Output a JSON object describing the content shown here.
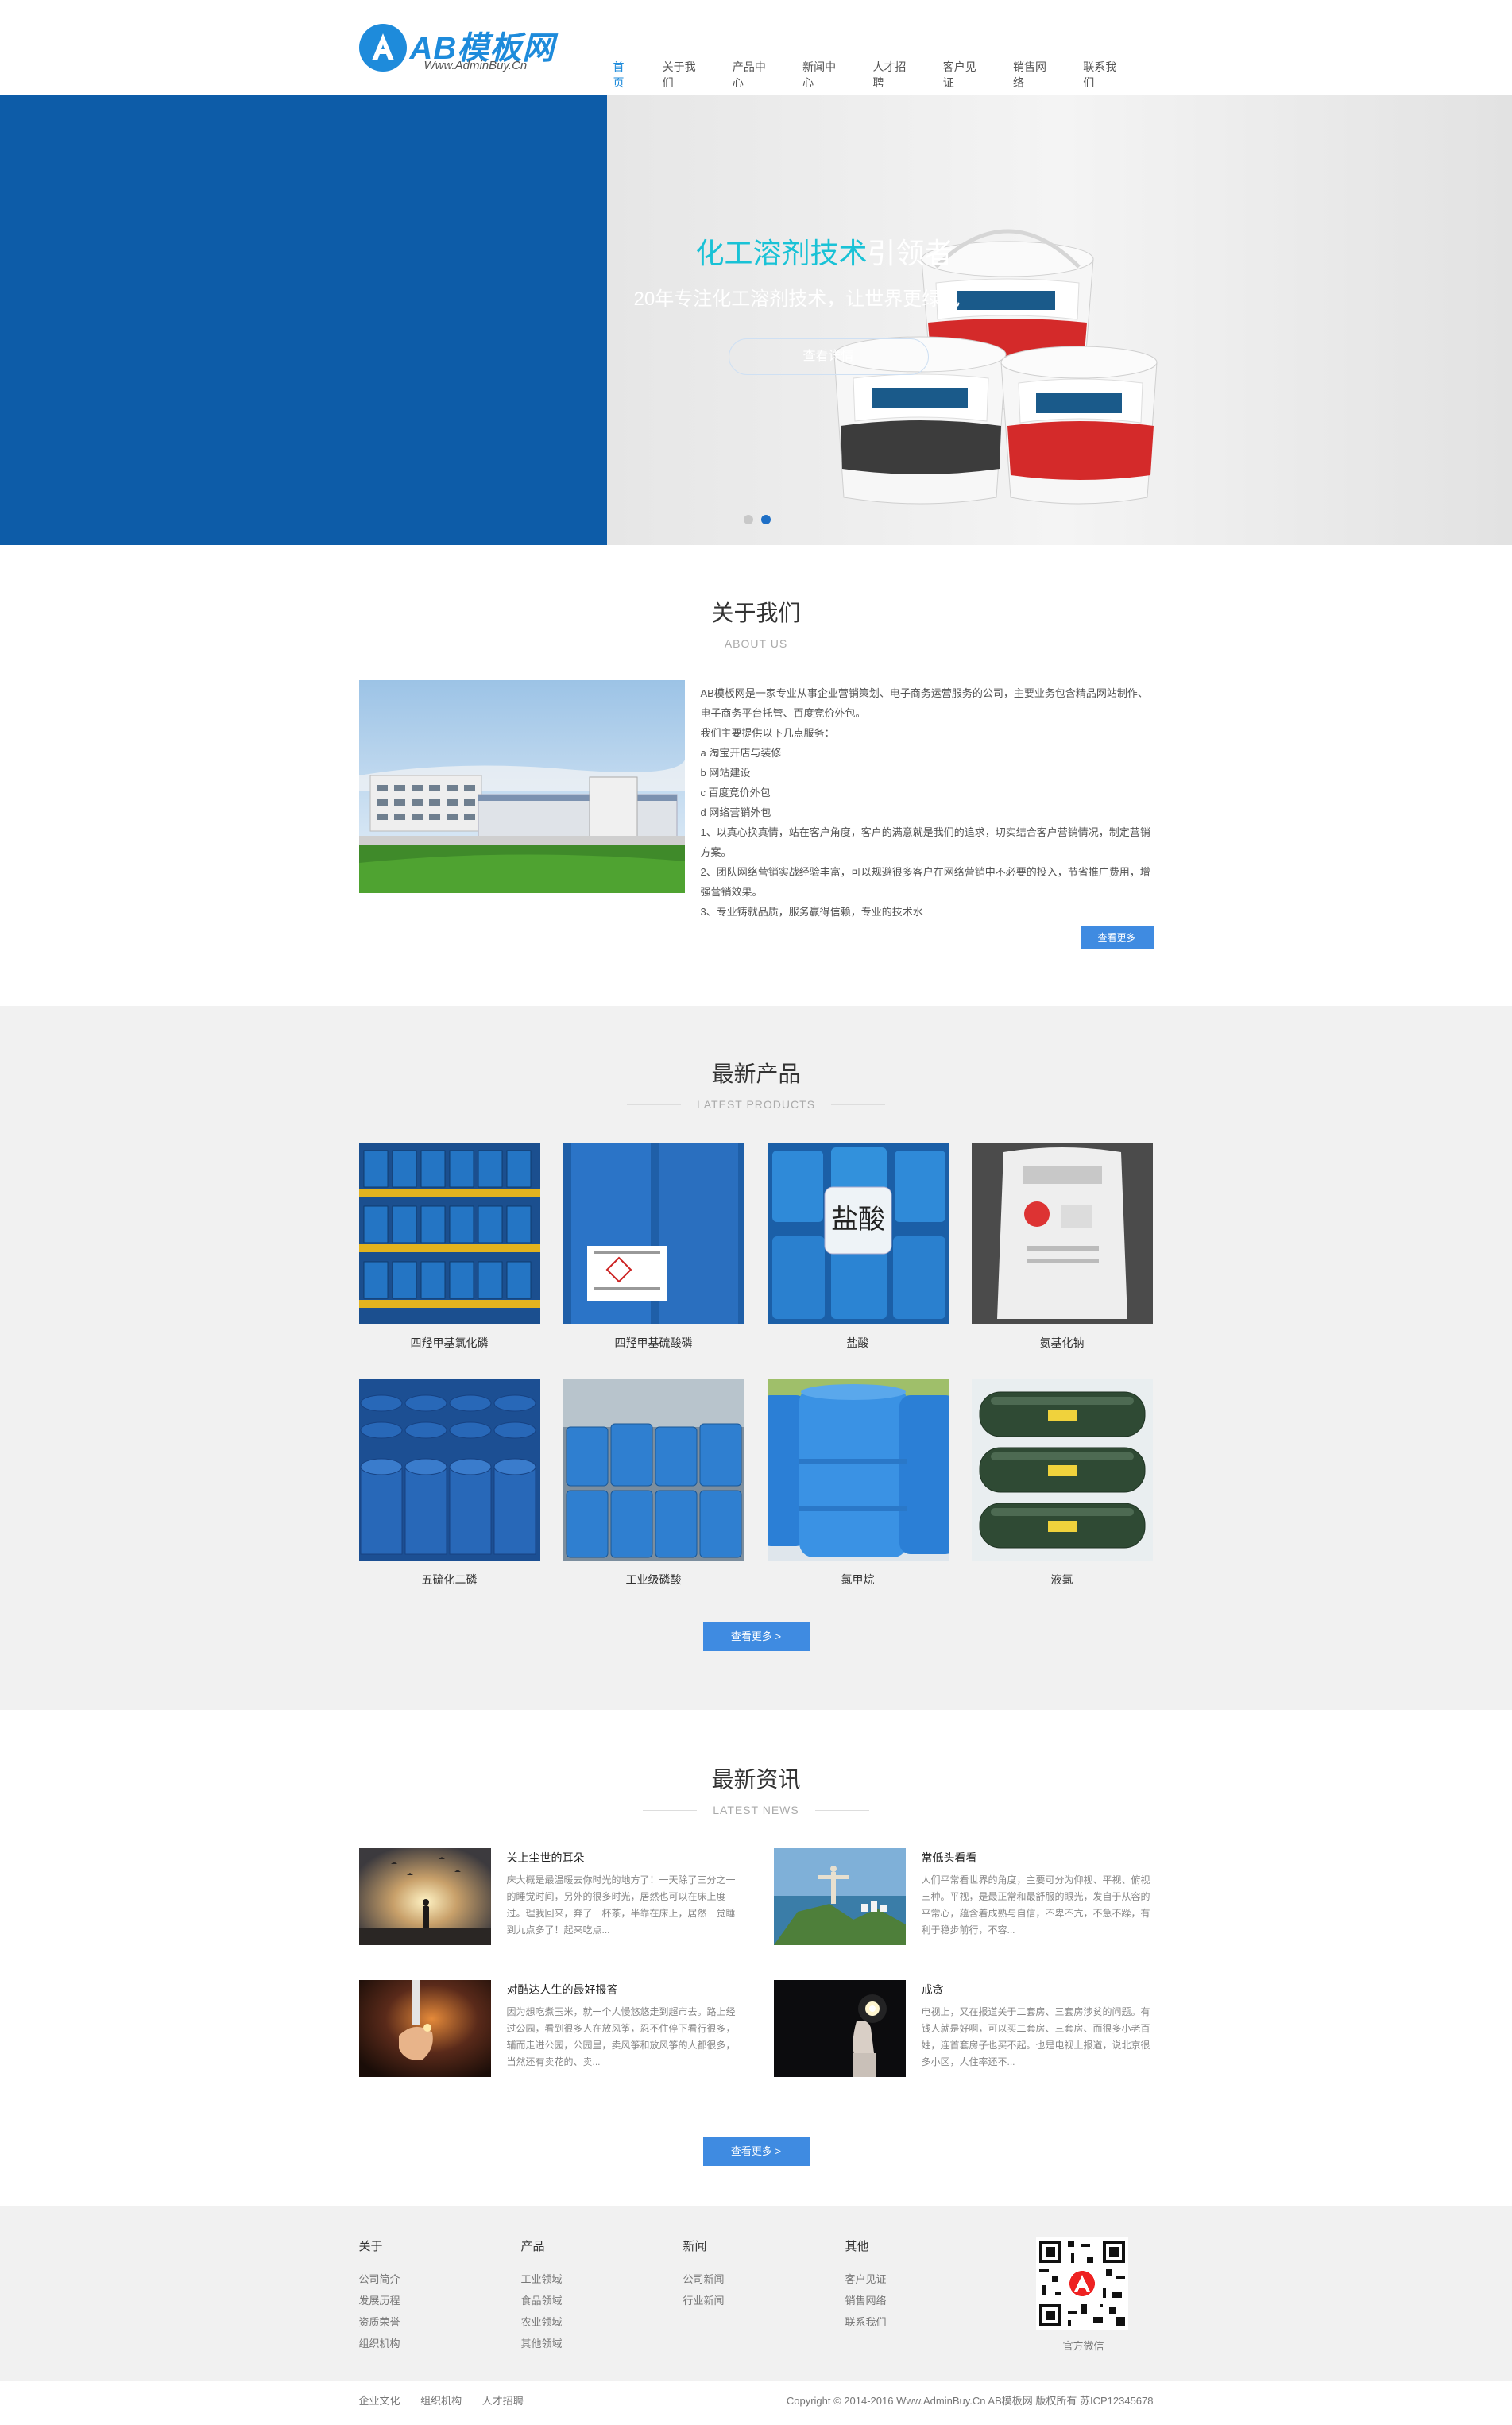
{
  "header": {
    "logo_title": "AB模板网",
    "logo_sub": "Www.AdminBuy.Cn",
    "nav": [
      "首页",
      "关于我们",
      "产品中心",
      "新闻中心",
      "人才招聘",
      "客户见证",
      "销售网络",
      "联系我们"
    ],
    "active_index": 0
  },
  "banner": {
    "headline_highlight": "化工溶剂技术",
    "headline_rest": "引领者",
    "subline": "20年专注化工溶剂技术，让世界更绿色",
    "button": "查看详情",
    "slide_count": 2,
    "active_slide": 2,
    "colors": {
      "left_panel": "#0d5ca8",
      "highlight": "#19c2d6"
    }
  },
  "about": {
    "title": "关于我们",
    "subtitle": "ABOUT US",
    "paragraphs": [
      "AB模板网是一家专业从事企业营销策划、电子商务运营服务的公司，主要业务包含精品网站制作、电子商务平台托管、百度竞价外包。",
      "我们主要提供以下几点服务：",
      "a  淘宝开店与装修",
      "b  网站建设",
      "c  百度竞价外包",
      "d  网络营销外包",
      "1、以真心换真情，站在客户角度，客户的满意就是我们的追求，切实结合客户营销情况，制定营销方案。",
      "2、团队网络营销实战经验丰富，可以规避很多客户在网络营销中不必要的投入，节省推广费用，增强营销效果。",
      "3、专业铸就品质，服务赢得信赖，专业的技术水"
    ],
    "more_button": "查看更多"
  },
  "products": {
    "title": "最新产品",
    "subtitle": "LATEST PRODUCTS",
    "items": [
      {
        "name": "四羟甲基氯化磷",
        "icon": "blue-drums-pallet"
      },
      {
        "name": "四羟甲基硫酸磷",
        "icon": "blue-drum-label"
      },
      {
        "name": "盐酸",
        "icon": "blue-jerrycans-hcl"
      },
      {
        "name": "氨基化钠",
        "icon": "white-sack"
      },
      {
        "name": "五硫化二磷",
        "icon": "blue-steel-drums"
      },
      {
        "name": "工业级磷酸",
        "icon": "blue-jerrycans"
      },
      {
        "name": "氯甲烷",
        "icon": "blue-plastic-drums"
      },
      {
        "name": "液氯",
        "icon": "green-gas-cylinders"
      }
    ],
    "sack_text": "盐",
    "more_button": "查看更多 >"
  },
  "news": {
    "title": "最新资讯",
    "subtitle": "LATEST NEWS",
    "items": [
      {
        "title": "关上尘世的耳朵",
        "desc": "床大概是最温暖去你时光的地方了！一天除了三分之一的睡觉时间，另外的很多时光，居然也可以在床上度过。理我回来，奔了一杯茶，半靠在床上，居然一觉睡到九点多了！起来吃点...",
        "icon": "sunset-birds"
      },
      {
        "title": "常低头看看",
        "desc": "人们平常看世界的角度，主要可分为仰视、平视、俯视三种。平视，是最正常和最舒服的眼光，发自于从容的平常心，蕴含着成熟与自信，不卑不亢，不急不躁，有利于稳步前行，不容...",
        "icon": "statue-city"
      },
      {
        "title": "对酷达人生的最好报答",
        "desc": "因为想吃煮玉米，就一个人慢悠悠走到超市去。路上经过公园，看到很多人在放风筝，忍不住停下看行很多，辅而走进公园，公园里，卖风筝和放风筝的人都很多，当然还有卖花的、卖...",
        "icon": "hand-light"
      },
      {
        "title": "戒贪",
        "desc": "电视上，又在报道关于二套房、三套房涉贫的问题。有钱人就是好啊，可以买二套房、三套房、而很多小老百姓，连首套房子也买不起。也是电视上报道，说北京很多小区，人住率还不...",
        "icon": "hand-bulb"
      }
    ],
    "more_button": "查看更多 >"
  },
  "footer": {
    "columns": [
      {
        "title": "关于",
        "links": [
          "公司简介",
          "发展历程",
          "资质荣誉",
          "组织机构"
        ]
      },
      {
        "title": "产品",
        "links": [
          "工业领域",
          "食品领域",
          "农业领域",
          "其他领域"
        ]
      },
      {
        "title": "新闻",
        "links": [
          "公司新闻",
          "行业新闻"
        ]
      },
      {
        "title": "其他",
        "links": [
          "客户见证",
          "销售网络",
          "联系我们"
        ]
      }
    ],
    "qr_caption": "官方微信",
    "bottom_links": [
      "企业文化",
      "组织机构",
      "人才招聘"
    ],
    "copyright": "Copyright © 2014-2016 Www.AdminBuy.Cn AB模板网 版权所有    苏ICP12345678"
  }
}
